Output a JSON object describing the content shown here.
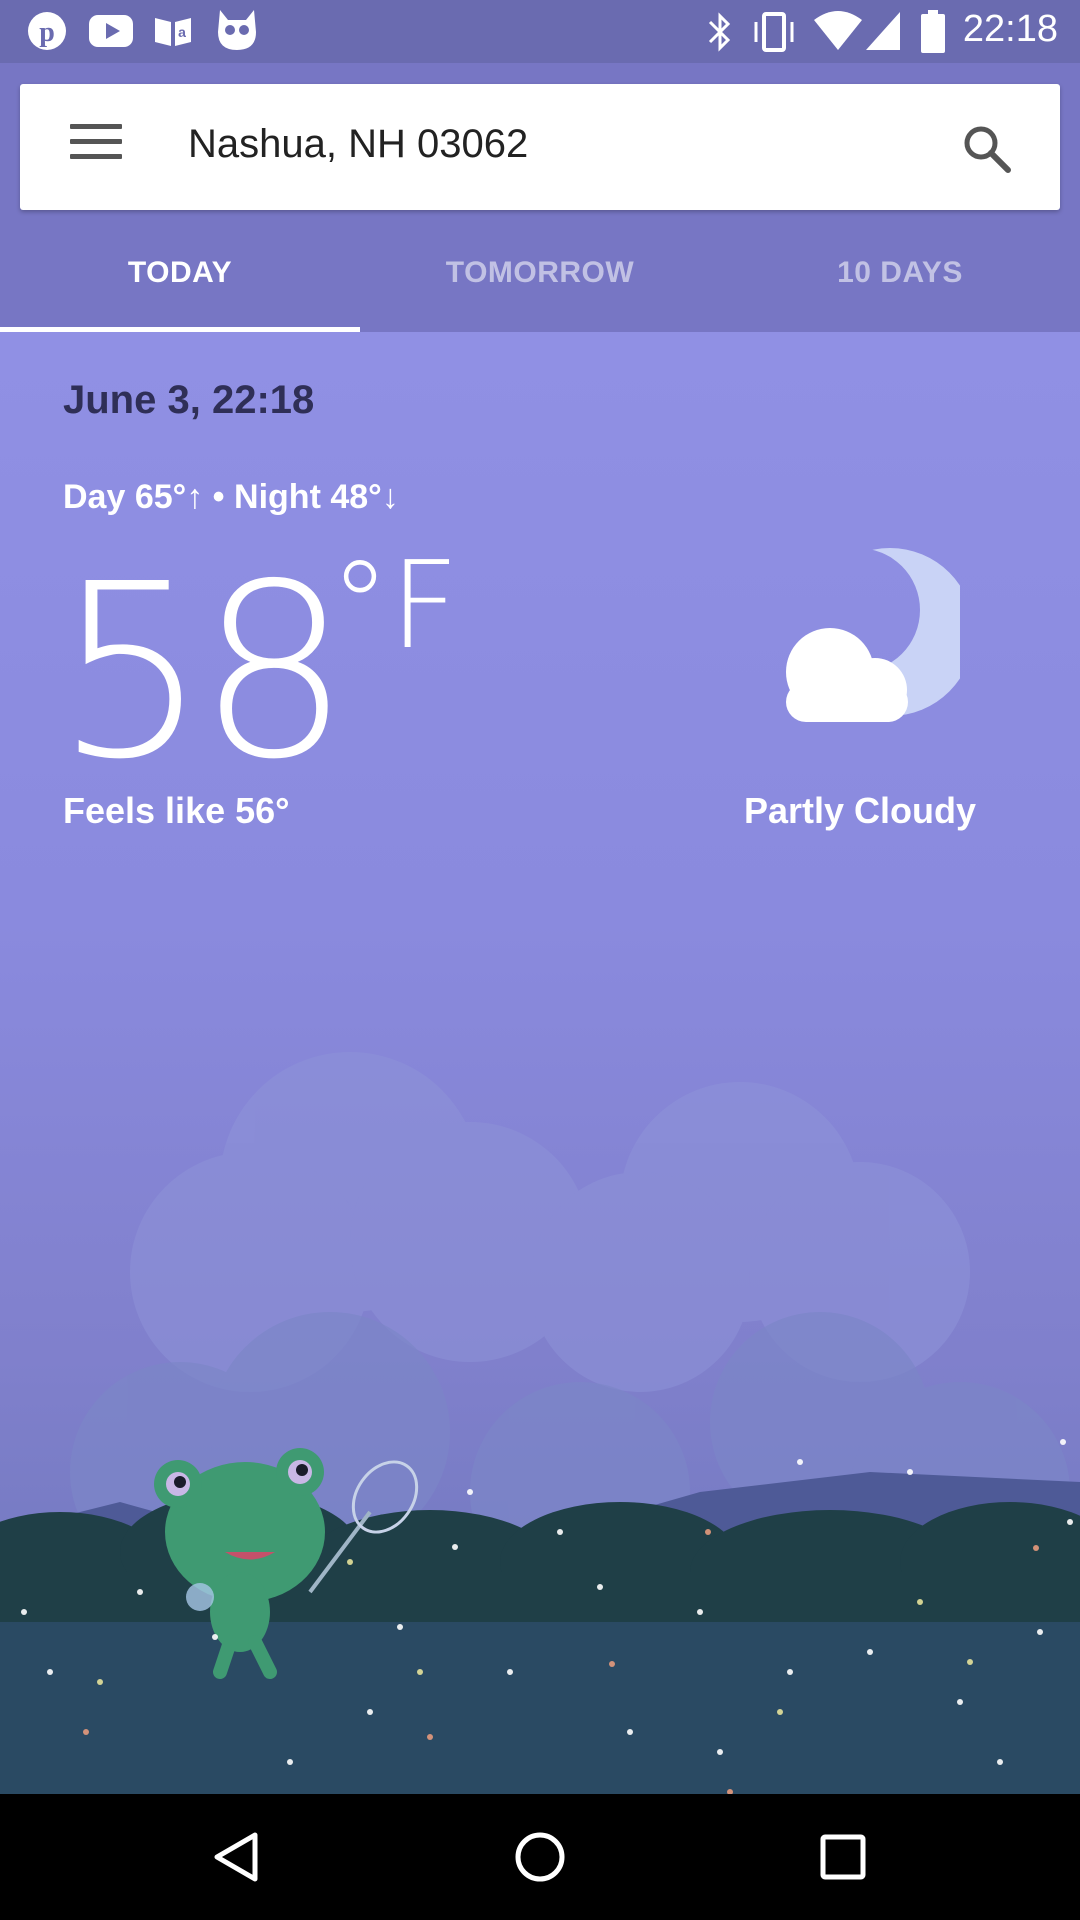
{
  "status_bar": {
    "time": "22:18",
    "left_icons": [
      "pinterest-icon",
      "youtube-icon",
      "amazon-kindle-icon",
      "duolingo-owl-icon"
    ],
    "right_icons": [
      "bluetooth-icon",
      "vibrate-icon",
      "wifi-icon",
      "cell-signal-icon",
      "battery-icon"
    ]
  },
  "search": {
    "location": "Nashua, NH 03062"
  },
  "tabs": [
    {
      "label": "TODAY",
      "active": true
    },
    {
      "label": "TOMORROW",
      "active": false
    },
    {
      "label": "10 DAYS",
      "active": false
    }
  ],
  "weather": {
    "datetime": "June 3, 22:18",
    "day_night": "Day 65°↑ • Night 48°↓",
    "temperature": "58",
    "unit": "°F",
    "feels_like": "Feels like 56°",
    "condition": "Partly Cloudy",
    "condition_icon": "partly-cloudy-night-icon"
  },
  "colors": {
    "status_bar": "#6a6bb0",
    "app_bar": "#7776c4",
    "sky": "#9090e4"
  },
  "nav_bar": {
    "icons": [
      "back-icon",
      "home-icon",
      "recents-icon"
    ]
  }
}
